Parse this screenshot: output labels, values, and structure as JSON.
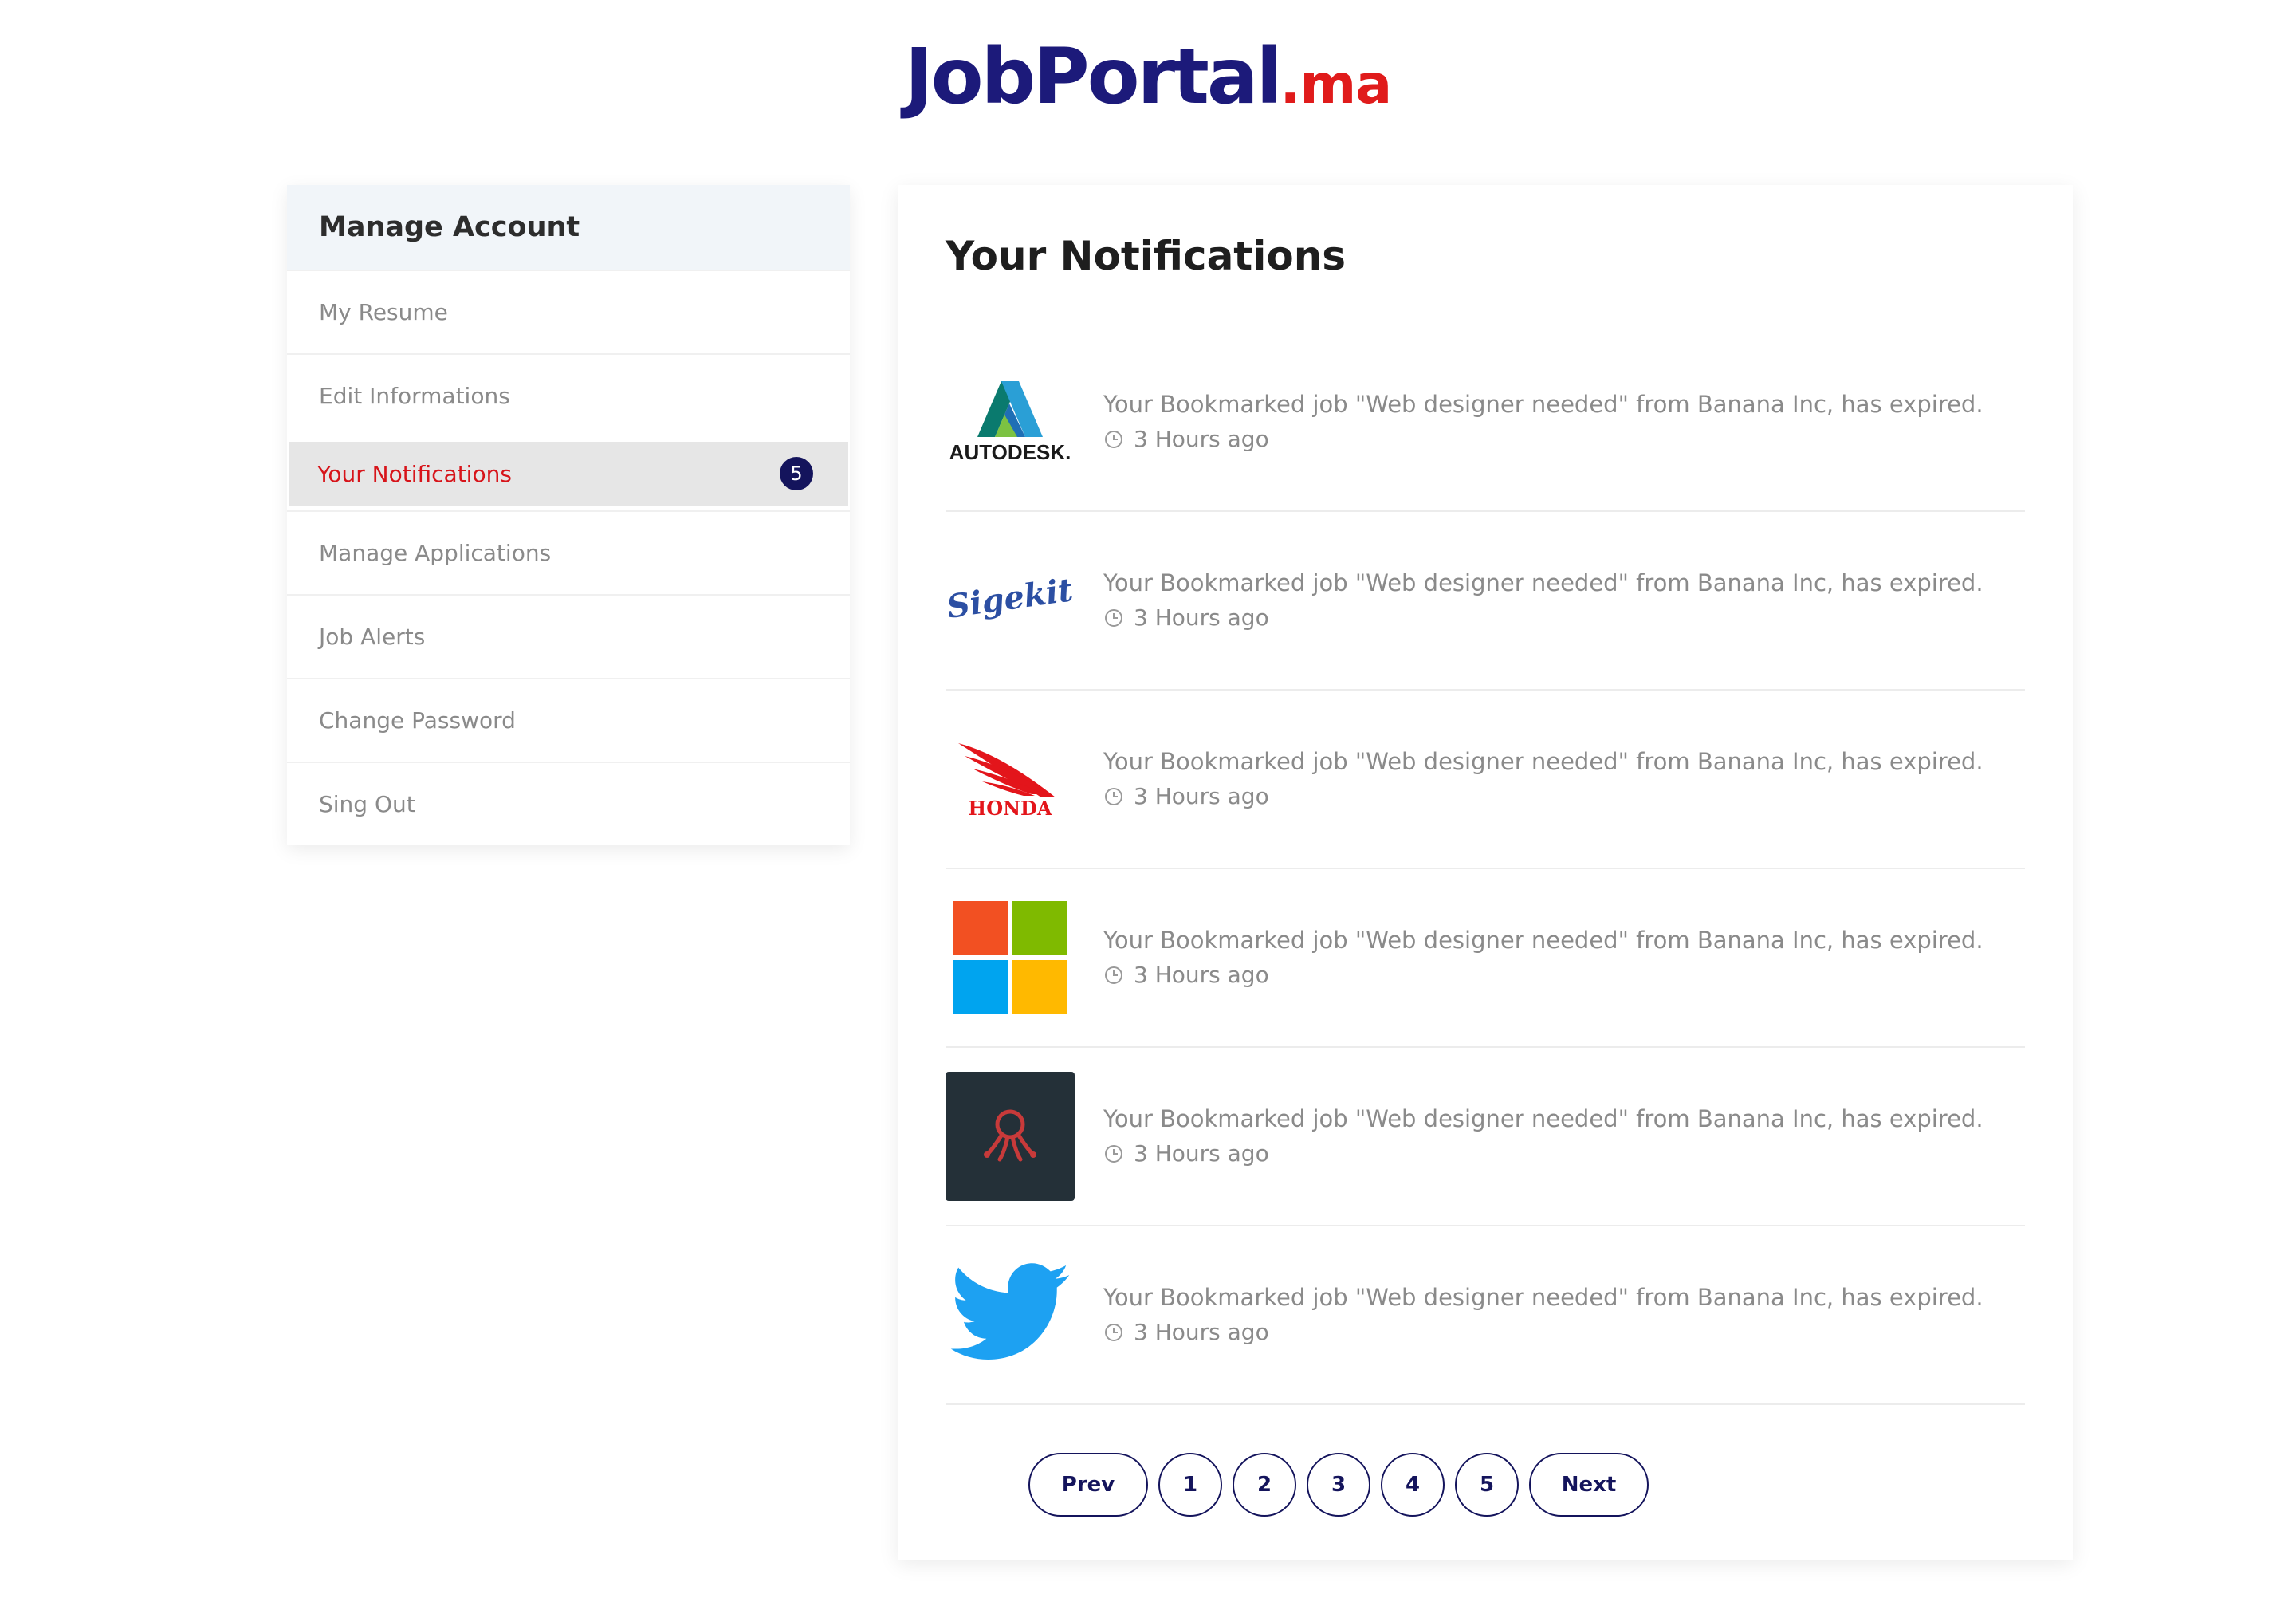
{
  "brand": {
    "name": "JobPortal",
    "tld": ".ma"
  },
  "sidebar": {
    "title": "Manage Account",
    "items": [
      {
        "label": "My Resume"
      },
      {
        "label": "Edit Informations"
      },
      {
        "label": "Your Notifications",
        "badge": "5",
        "active": true
      },
      {
        "label": "Manage Applications"
      },
      {
        "label": "Job Alerts"
      },
      {
        "label": "Change Password"
      },
      {
        "label": "Sing Out"
      }
    ]
  },
  "main": {
    "title": "Your Notifications",
    "notifications": [
      {
        "company_logo": "autodesk-logo",
        "logo_text": "AUTODESK.",
        "text": "Your Bookmarked job \"Web designer needed\" from Banana Inc, has expired.",
        "time": "3 Hours ago"
      },
      {
        "company_logo": "sigekit-logo",
        "logo_text": "Sigekit",
        "text": "Your Bookmarked job \"Web designer needed\" from Banana Inc, has expired.",
        "time": "3 Hours ago"
      },
      {
        "company_logo": "honda-logo",
        "logo_text": "HONDA",
        "text": "Your Bookmarked job \"Web designer needed\" from Banana Inc, has expired.",
        "time": "3 Hours ago"
      },
      {
        "company_logo": "microsoft-logo",
        "text": "Your Bookmarked job \"Web designer needed\" from Banana Inc, has expired.",
        "time": "3 Hours ago"
      },
      {
        "company_logo": "octopus-logo",
        "text": "Your Bookmarked job \"Web designer needed\" from Banana Inc, has expired.",
        "time": "3 Hours ago"
      },
      {
        "company_logo": "twitter-logo",
        "text": "Your Bookmarked job \"Web designer needed\" from Banana Inc, has expired.",
        "time": "3 Hours ago"
      }
    ]
  },
  "pagination": {
    "prev": "Prev",
    "pages": [
      "1",
      "2",
      "3",
      "4",
      "5"
    ],
    "next": "Next"
  },
  "colors": {
    "brand_navy": "#1c1a7a",
    "brand_red": "#e01b1b",
    "active_text": "#d7141a",
    "badge_bg": "#14145c"
  }
}
